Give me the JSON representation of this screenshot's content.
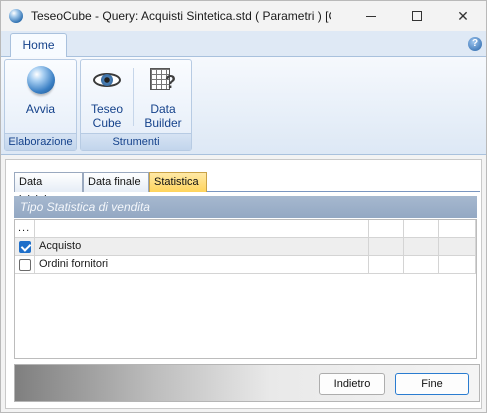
{
  "window": {
    "title": "TeseoCube - Query: Acquisti Sintetica.std ( Parametri ) [Cie...",
    "controls": {
      "minimize": "minimize-icon",
      "maximize": "maximize-icon",
      "close": "close-icon"
    },
    "close_glyph": "✕"
  },
  "ribbon": {
    "tab": "Home",
    "help_glyph": "?",
    "groups": {
      "elaborazione": {
        "label": "Elaborazione",
        "avvia": "Avvia"
      },
      "strumenti": {
        "label": "Strumenti",
        "teseo_line1": "Teseo",
        "teseo_line2": "Cube",
        "data_line1": "Data",
        "data_line2": "Builder"
      }
    }
  },
  "tabs": [
    "Data iniziale",
    "Data finale",
    "Statistica"
  ],
  "active_tab": "Statistica",
  "section": {
    "title": "Tipo Statistica di vendita"
  },
  "grid": {
    "header_marker": "...",
    "rows": [
      {
        "label": "Acquisto",
        "checked": true
      },
      {
        "label": "Ordini fornitori",
        "checked": false
      }
    ]
  },
  "buttons": {
    "back": "Indietro",
    "finish": "Fine"
  },
  "colors": {
    "accent": "#1f6fc9",
    "ribbon_text": "#15428b",
    "active_tab": "#ffd45c",
    "section_header": "#93a8c3"
  }
}
